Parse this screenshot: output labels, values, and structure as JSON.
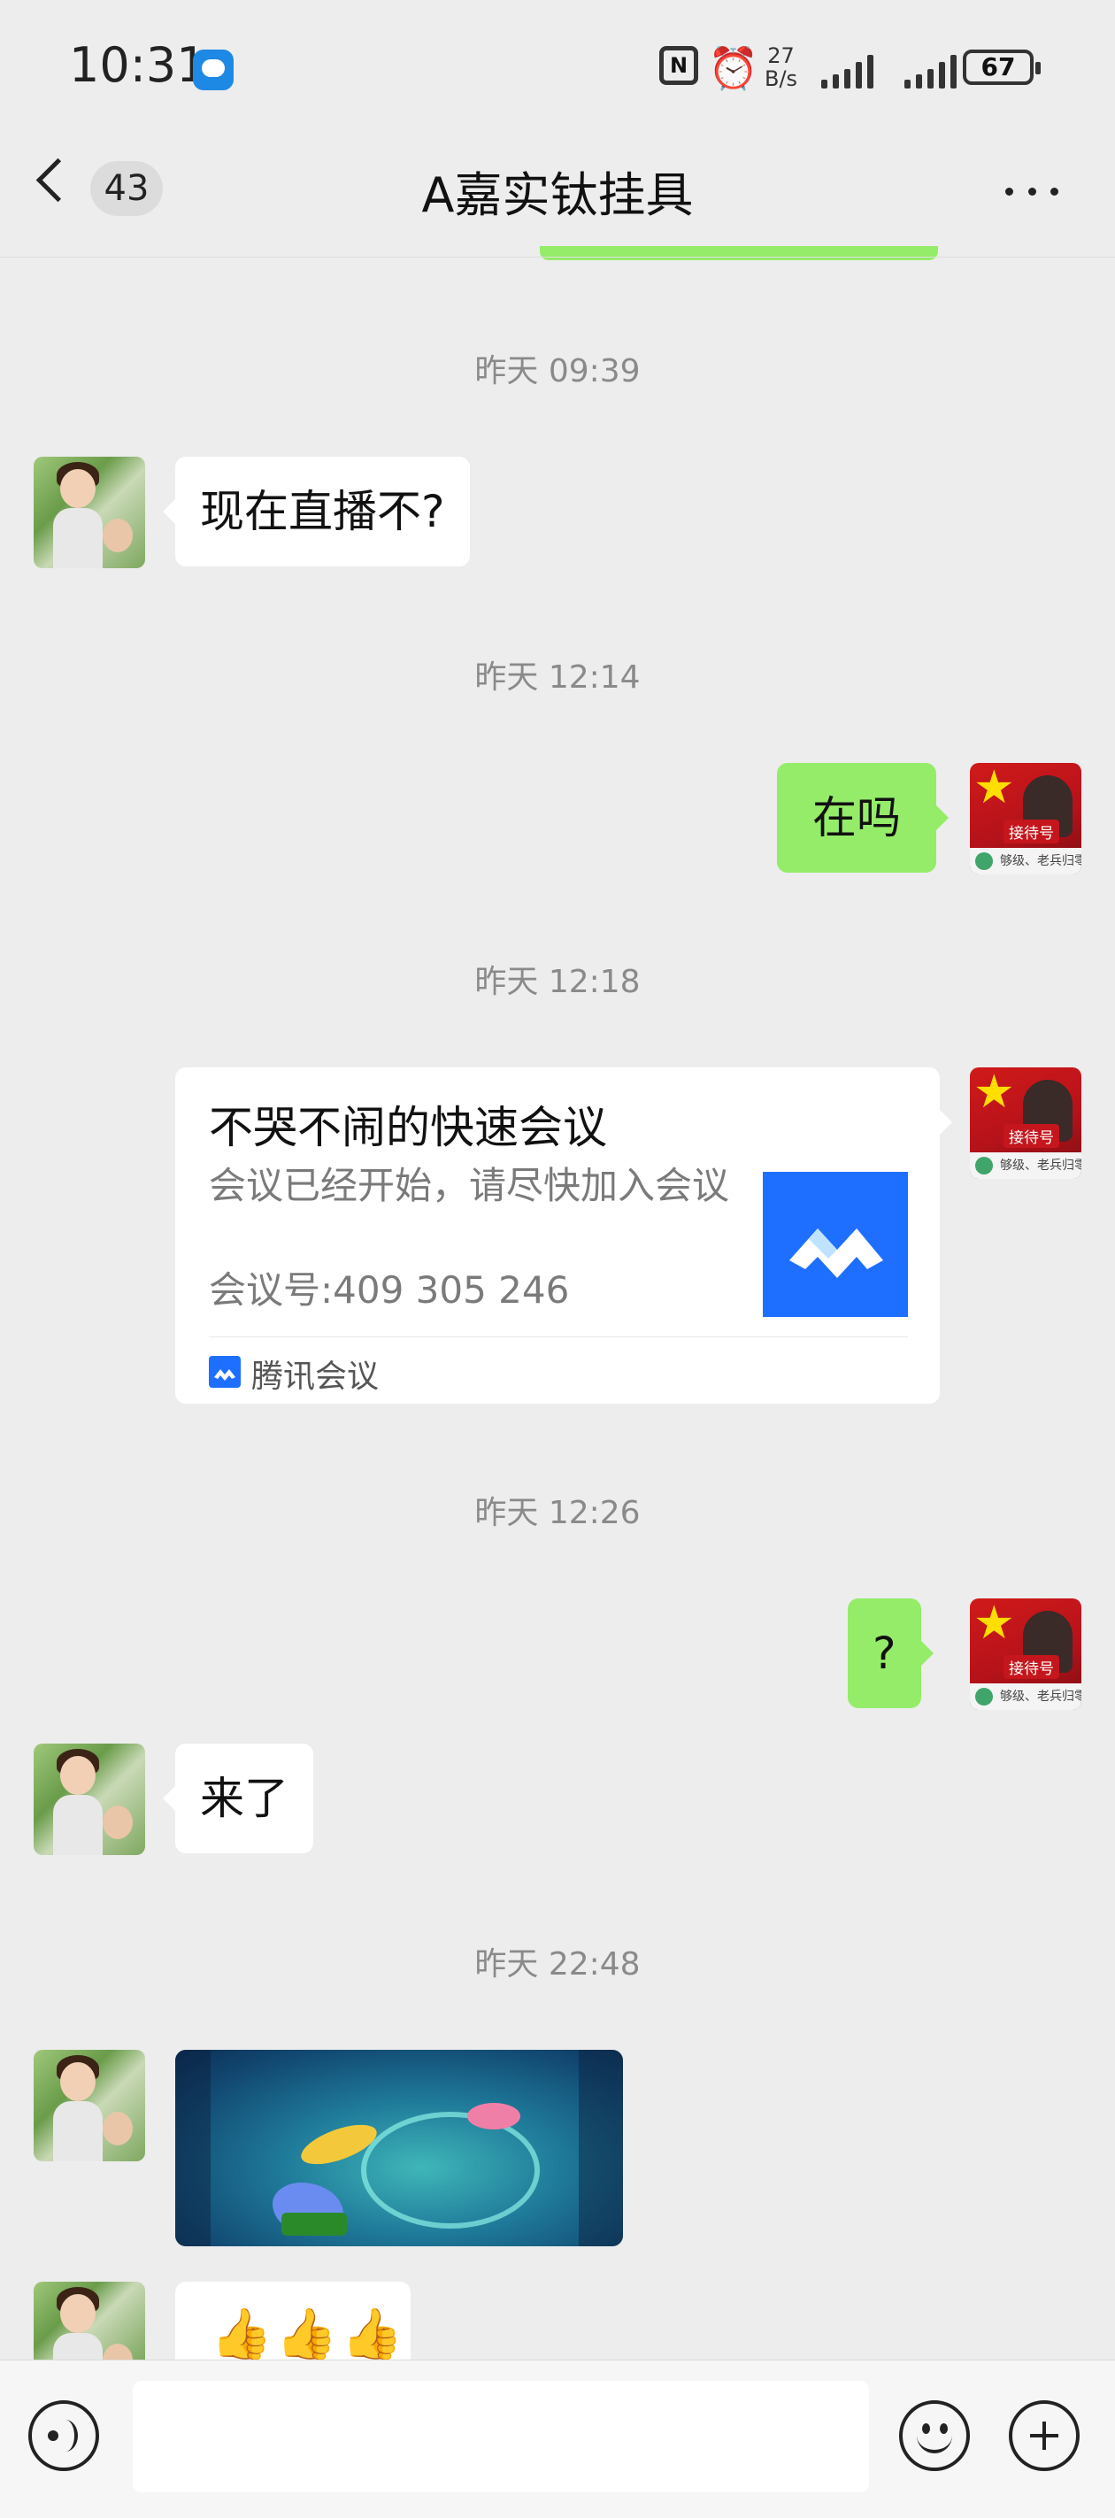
{
  "status_bar": {
    "time": "10:31",
    "net_speed_value": "27",
    "net_speed_unit": "B/s",
    "nfc_label": "N",
    "battery": "67"
  },
  "nav": {
    "unread_count": "43",
    "title": "A嘉实钛挂具"
  },
  "avatars": {
    "right_tag": "接待号",
    "right_caption": "够级、老兵归零"
  },
  "messages": {
    "ts1": "昨天 09:39",
    "m1": "现在直播不?",
    "ts2": "昨天 12:14",
    "m2": "在吗",
    "ts3": "昨天 12:18",
    "card": {
      "title": "不哭不闹的快速会议",
      "desc": "会议已经开始，请尽快加入会议",
      "meeting_id": "会议号:409 305 246",
      "source": "腾讯会议"
    },
    "ts4": "昨天 12:26",
    "m3": "?",
    "m4": "来了",
    "ts5": "昨天 22:48",
    "m5": "👍👍👍"
  },
  "colors": {
    "background": "#ededed",
    "sent_bubble": "#95ec69",
    "received_bubble": "#ffffff",
    "meeting_brand": "#1e6fff"
  }
}
